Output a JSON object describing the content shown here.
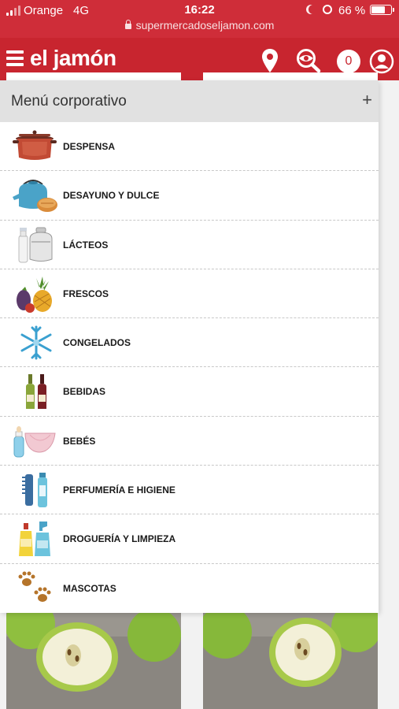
{
  "status_bar": {
    "carrier": "Orange",
    "network": "4G",
    "time": "16:22",
    "battery": "66 %",
    "battery_level": 0.66,
    "url": "supermercadoseljamon.com"
  },
  "header": {
    "logo": "el jamón",
    "cart_count": "0",
    "brand_color": "#c8252f"
  },
  "menu": {
    "title": "Menú corporativo",
    "expand_symbol": "+",
    "items": [
      {
        "label": "DESPENSA",
        "icon": "cooking-pot-icon"
      },
      {
        "label": "DESAYUNO Y DULCE",
        "icon": "kettle-icon"
      },
      {
        "label": "LÁCTEOS",
        "icon": "milk-can-icon"
      },
      {
        "label": "FRESCOS",
        "icon": "pineapple-icon"
      },
      {
        "label": "CONGELADOS",
        "icon": "snowflake-icon"
      },
      {
        "label": "BEBIDAS",
        "icon": "wine-bottles-icon"
      },
      {
        "label": "BEBÉS",
        "icon": "diaper-icon"
      },
      {
        "label": "PERFUMERÍA E HIGIENE",
        "icon": "comb-icon"
      },
      {
        "label": "DROGUERÍA Y LIMPIEZA",
        "icon": "cleaning-products-icon"
      },
      {
        "label": "MASCOTAS",
        "icon": "paw-prints-icon"
      }
    ]
  }
}
